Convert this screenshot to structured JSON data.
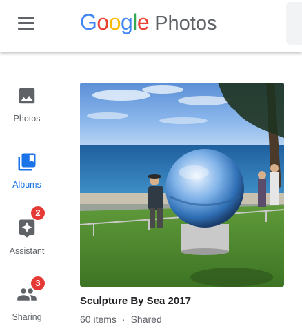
{
  "header": {
    "logo_letters": [
      {
        "char": "G",
        "color": "#4285F4"
      },
      {
        "char": "o",
        "color": "#EA4335"
      },
      {
        "char": "o",
        "color": "#FBBC05"
      },
      {
        "char": "g",
        "color": "#4285F4"
      },
      {
        "char": "l",
        "color": "#34A853"
      },
      {
        "char": "e",
        "color": "#EA4335"
      }
    ],
    "product_name": "Photos",
    "menu_icon": "hamburger-menu-icon"
  },
  "nav": {
    "items": [
      {
        "label": "Photos",
        "icon": "photo-icon",
        "active": false,
        "badge": null
      },
      {
        "label": "Albums",
        "icon": "albums-icon",
        "active": true,
        "badge": null
      },
      {
        "label": "Assistant",
        "icon": "assistant-icon",
        "active": false,
        "badge": "2"
      },
      {
        "label": "Sharing",
        "icon": "people-icon",
        "active": false,
        "badge": "3"
      }
    ]
  },
  "album": {
    "title": "Sculpture By Sea 2017",
    "count": "60 items",
    "separator": "·",
    "status": "Shared"
  },
  "colors": {
    "accent": "#1a73e8",
    "badge": "#e53935",
    "icon_gray": "#5f6368"
  }
}
